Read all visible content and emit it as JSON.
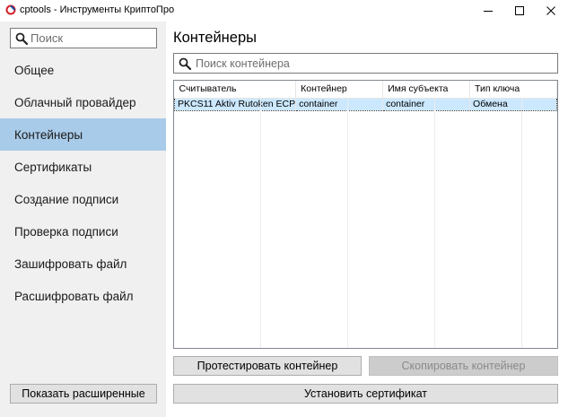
{
  "window": {
    "title": "cptools - Инструменты КриптоПро",
    "icon": "cryptopro-logo-icon",
    "controls": [
      "minimize",
      "maximize",
      "close"
    ]
  },
  "sidebar": {
    "search_placeholder": "Поиск",
    "items": [
      {
        "label": "Общее",
        "active": false
      },
      {
        "label": "Облачный провайдер",
        "active": false
      },
      {
        "label": "Контейнеры",
        "active": true
      },
      {
        "label": "Сертификаты",
        "active": false
      },
      {
        "label": "Создание подписи",
        "active": false
      },
      {
        "label": "Проверка подписи",
        "active": false
      },
      {
        "label": "Зашифровать файл",
        "active": false
      },
      {
        "label": "Расшифровать файл",
        "active": false
      }
    ],
    "show_advanced_label": "Показать расширенные"
  },
  "main": {
    "title": "Контейнеры",
    "search_placeholder": "Поиск контейнера",
    "table": {
      "columns": [
        "Считыватель",
        "Контейнер",
        "Имя субъекта",
        "Тип ключа"
      ],
      "rows": [
        {
          "reader": "PKCS11 Aktiv Rutoken ECP",
          "container": "container",
          "subject": "container",
          "key_type": "Обмена",
          "selected": true
        }
      ]
    },
    "buttons": {
      "test_container": "Протестировать контейнер",
      "copy_container": "Скопировать контейнер",
      "install_certificate": "Установить сертификат"
    }
  },
  "colors": {
    "sidebar_bg": "#f0f0f0",
    "active_item_bg": "#a8cbe9",
    "selected_row_bg": "#cce8ff",
    "button_bg": "#e1e1e1",
    "disabled_button_bg": "#cccccc"
  }
}
